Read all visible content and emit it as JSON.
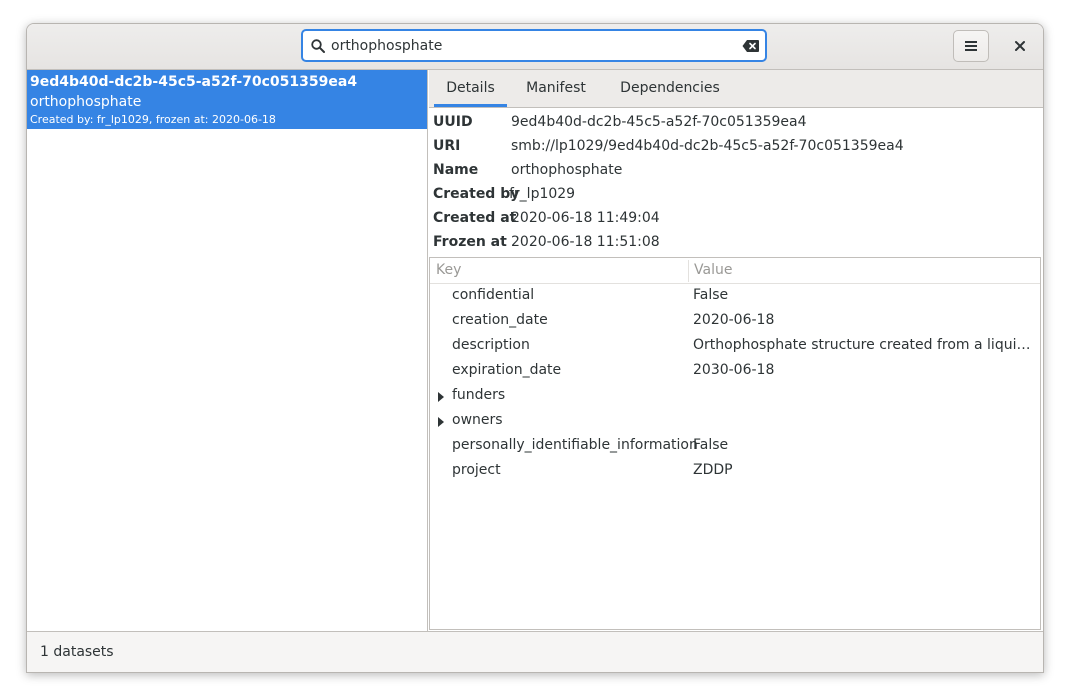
{
  "header": {
    "search": {
      "value": "orthophosphate"
    }
  },
  "sidebar": {
    "datasets": [
      {
        "uuid": "9ed4b40d-dc2b-45c5-a52f-70c051359ea4",
        "name": "orthophosphate",
        "meta": "Created by: fr_lp1029, frozen at: 2020-06-18",
        "selected": true
      }
    ]
  },
  "tabs": [
    {
      "label": "Details",
      "active": true
    },
    {
      "label": "Manifest",
      "active": false
    },
    {
      "label": "Dependencies",
      "active": false
    }
  ],
  "details": {
    "props": [
      {
        "label": "UUID",
        "value": "9ed4b40d-dc2b-45c5-a52f-70c051359ea4"
      },
      {
        "label": "URI",
        "value": "smb://lp1029/9ed4b40d-dc2b-45c5-a52f-70c051359ea4"
      },
      {
        "label": "Name",
        "value": "orthophosphate"
      },
      {
        "label": "Created by",
        "value": "fr_lp1029"
      },
      {
        "label": "Created at",
        "value": "2020-06-18 11:49:04"
      },
      {
        "label": "Frozen at",
        "value": "2020-06-18 11:51:08"
      }
    ],
    "readme": {
      "key_header": "Key",
      "value_header": "Value",
      "rows": [
        {
          "key": "confidential",
          "value": "False",
          "expandable": false
        },
        {
          "key": "creation_date",
          "value": "2020-06-18",
          "expandable": false
        },
        {
          "key": "description",
          "value": "Orthophosphate structure created from a liquid qu…",
          "expandable": false
        },
        {
          "key": "expiration_date",
          "value": "2030-06-18",
          "expandable": false
        },
        {
          "key": "funders",
          "value": "",
          "expandable": true
        },
        {
          "key": "owners",
          "value": "",
          "expandable": true
        },
        {
          "key": "personally_identifiable_information",
          "value": "False",
          "expandable": false
        },
        {
          "key": "project",
          "value": "ZDDP",
          "expandable": false
        }
      ]
    }
  },
  "status": {
    "text": "1 datasets"
  },
  "colors": {
    "accent": "#3584e4",
    "headerbar": "#e8e6e3",
    "border": "#c2bfbb",
    "text": "#2e3436"
  },
  "icons": {
    "search": "search-icon",
    "clear": "edit-clear-icon",
    "menu": "hamburger-menu-icon",
    "close": "close-icon",
    "expander": "expander-arrow-icon"
  }
}
